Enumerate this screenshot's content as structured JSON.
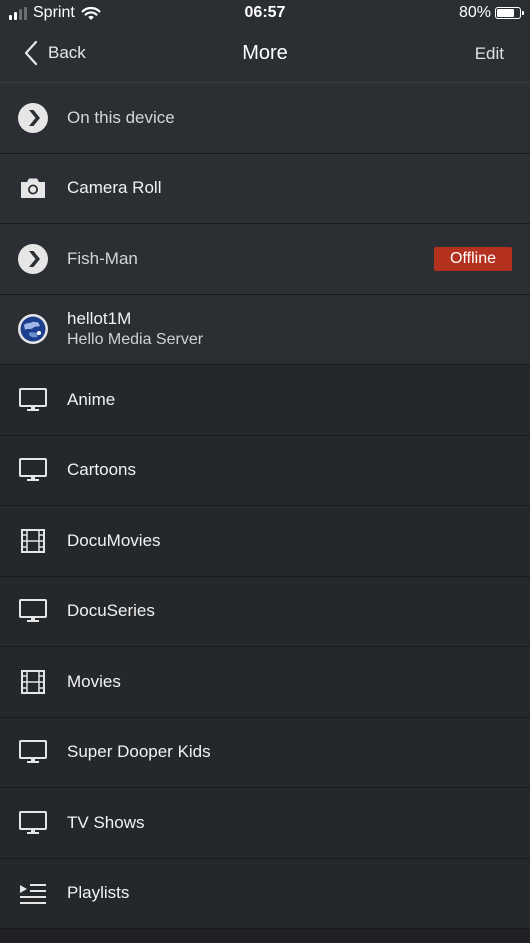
{
  "status_bar": {
    "carrier": "Sprint",
    "time": "06:57",
    "battery_percent": "80%",
    "battery_level": 0.8,
    "signal_bars_active": 2,
    "signal_bars_total": 4
  },
  "nav": {
    "back_label": "Back",
    "title": "More",
    "edit_label": "Edit"
  },
  "servers": [
    {
      "label": "On this device",
      "icon": "plex-chevron-icon"
    },
    {
      "label": "Camera Roll",
      "icon": "camera-icon"
    },
    {
      "label": "Fish-Man",
      "icon": "plex-chevron-icon",
      "badge": "Offline"
    },
    {
      "label": "hellot1M",
      "subtitle": "Hello Media Server",
      "icon": "globe-server-icon"
    }
  ],
  "libraries": [
    {
      "label": "Anime",
      "icon": "tv-icon"
    },
    {
      "label": "Cartoons",
      "icon": "tv-icon"
    },
    {
      "label": "DocuMovies",
      "icon": "film-icon"
    },
    {
      "label": "DocuSeries",
      "icon": "tv-icon"
    },
    {
      "label": "Movies",
      "icon": "film-icon"
    },
    {
      "label": "Super Dooper Kids",
      "icon": "tv-icon"
    },
    {
      "label": "TV Shows",
      "icon": "tv-icon"
    },
    {
      "label": "Playlists",
      "icon": "playlist-icon"
    }
  ],
  "colors": {
    "background": "#1f2124",
    "header": "#2b2f34",
    "offline_badge": "#b5311f"
  }
}
